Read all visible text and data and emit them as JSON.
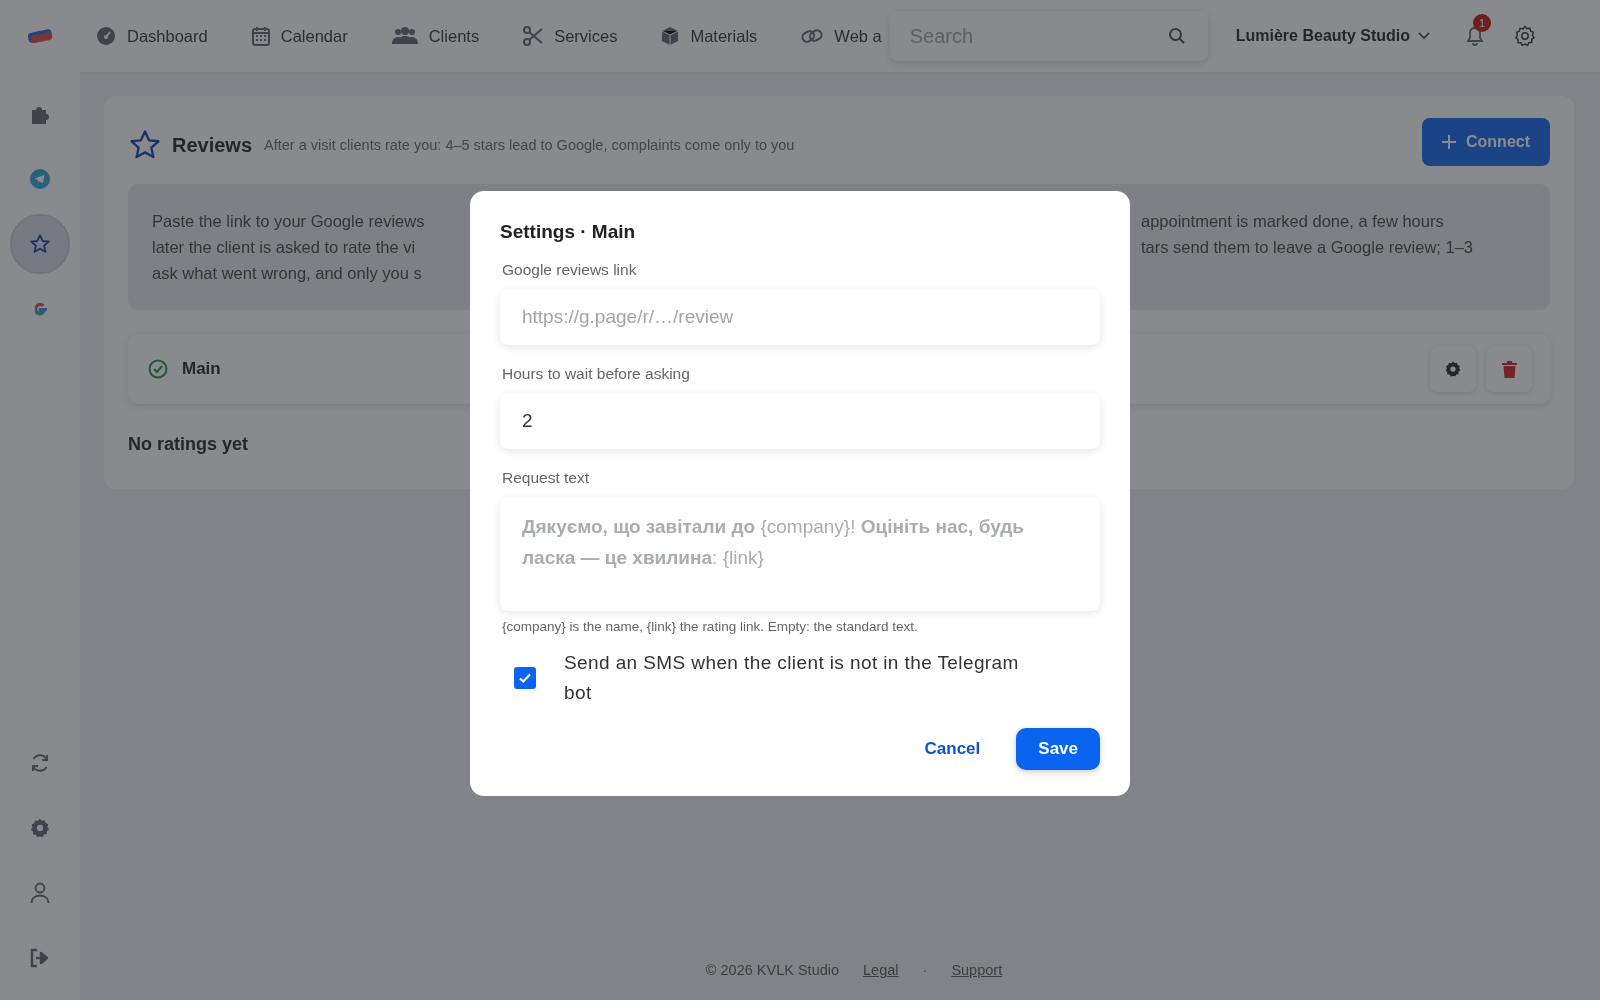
{
  "nav": {
    "items": [
      {
        "label": "Dashboard"
      },
      {
        "label": "Calendar"
      },
      {
        "label": "Clients"
      },
      {
        "label": "Services"
      },
      {
        "label": "Materials"
      },
      {
        "label": "Web a"
      }
    ],
    "search": {
      "placeholder": "Search"
    },
    "studio": "Lumière Beauty Studio",
    "notifications": "1"
  },
  "sidebar": {
    "top": [
      {
        "selected": false
      },
      {
        "selected": false
      },
      {
        "selected": true
      },
      {
        "selected": false
      }
    ],
    "bottom": [
      {
        "selected": false
      },
      {
        "selected": false
      },
      {
        "selected": false
      },
      {
        "selected": false
      }
    ]
  },
  "header": {
    "title": "Reviews",
    "subtitle": "After a visit clients rate you: 4–5 stars lead to Google, complaints come only to you",
    "button": "Connect"
  },
  "info": {
    "left_lines": [
      "Paste the link to your Google reviews",
      "later the client is asked to rate the vi",
      "ask what went wrong, and only you s"
    ],
    "right_lines": [
      "appointment is marked done, a few hours",
      "tars send them to leave a Google review; 1–3"
    ]
  },
  "integration": {
    "name": "Main",
    "active": true
  },
  "empty": "No ratings yet",
  "footer": {
    "copyright": "© 2026 KVLK Studio",
    "links": [
      "Legal",
      "Support"
    ],
    "separator": "·"
  },
  "modal": {
    "title": "Settings · Main",
    "fields": [
      {
        "label": "Google reviews link",
        "placeholder": "https://g.page/r/…/review"
      },
      {
        "label": "Hours to wait before asking",
        "value": "2"
      }
    ],
    "request": {
      "label": "Request text",
      "placeholder": "**Дякуємо, що завітали до** {company}! **Оцініть нас, будь ласка — це хвилина**: {link}",
      "hint": "{company} is the name, {link} the rating link. Empty: the standard text."
    },
    "sms": {
      "label": "Send an SMS when the client is not in the Telegram bot",
      "checked": true
    },
    "cancel": "Cancel",
    "save": "Save"
  }
}
